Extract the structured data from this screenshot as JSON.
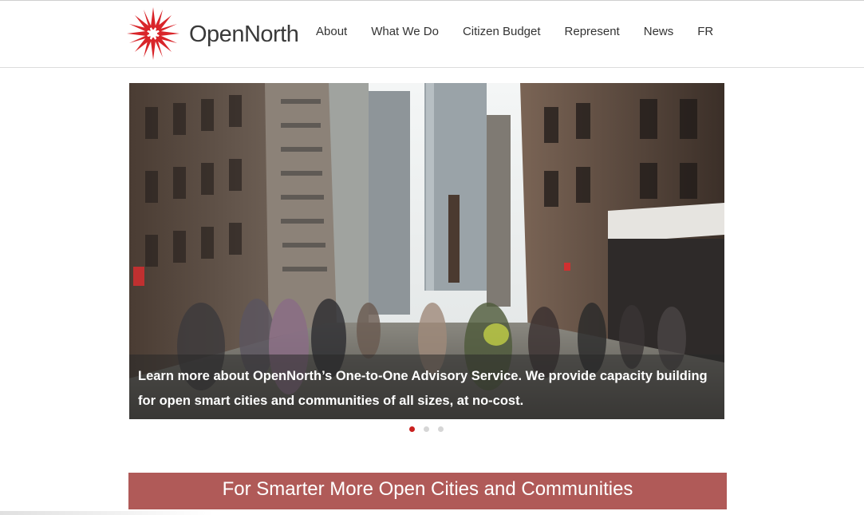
{
  "header": {
    "logo_text": "OpenNorth",
    "nav": [
      {
        "label": "About"
      },
      {
        "label": "What We Do"
      },
      {
        "label": "Citizen Budget"
      },
      {
        "label": "Represent"
      },
      {
        "label": "News"
      },
      {
        "label": "FR"
      }
    ]
  },
  "slider": {
    "caption": "Learn more about OpenNorth’s One-to-One Advisory Service. We provide capacity building for open smart cities and communities of all sizes, at no-cost.",
    "slide_count": 3,
    "active_slide": 1
  },
  "banner": {
    "heading": "For Smarter More Open Cities and Communities"
  },
  "colors": {
    "brand_red": "#c9201f",
    "banner_bg": "#b05a58",
    "nav_text": "#333333"
  }
}
